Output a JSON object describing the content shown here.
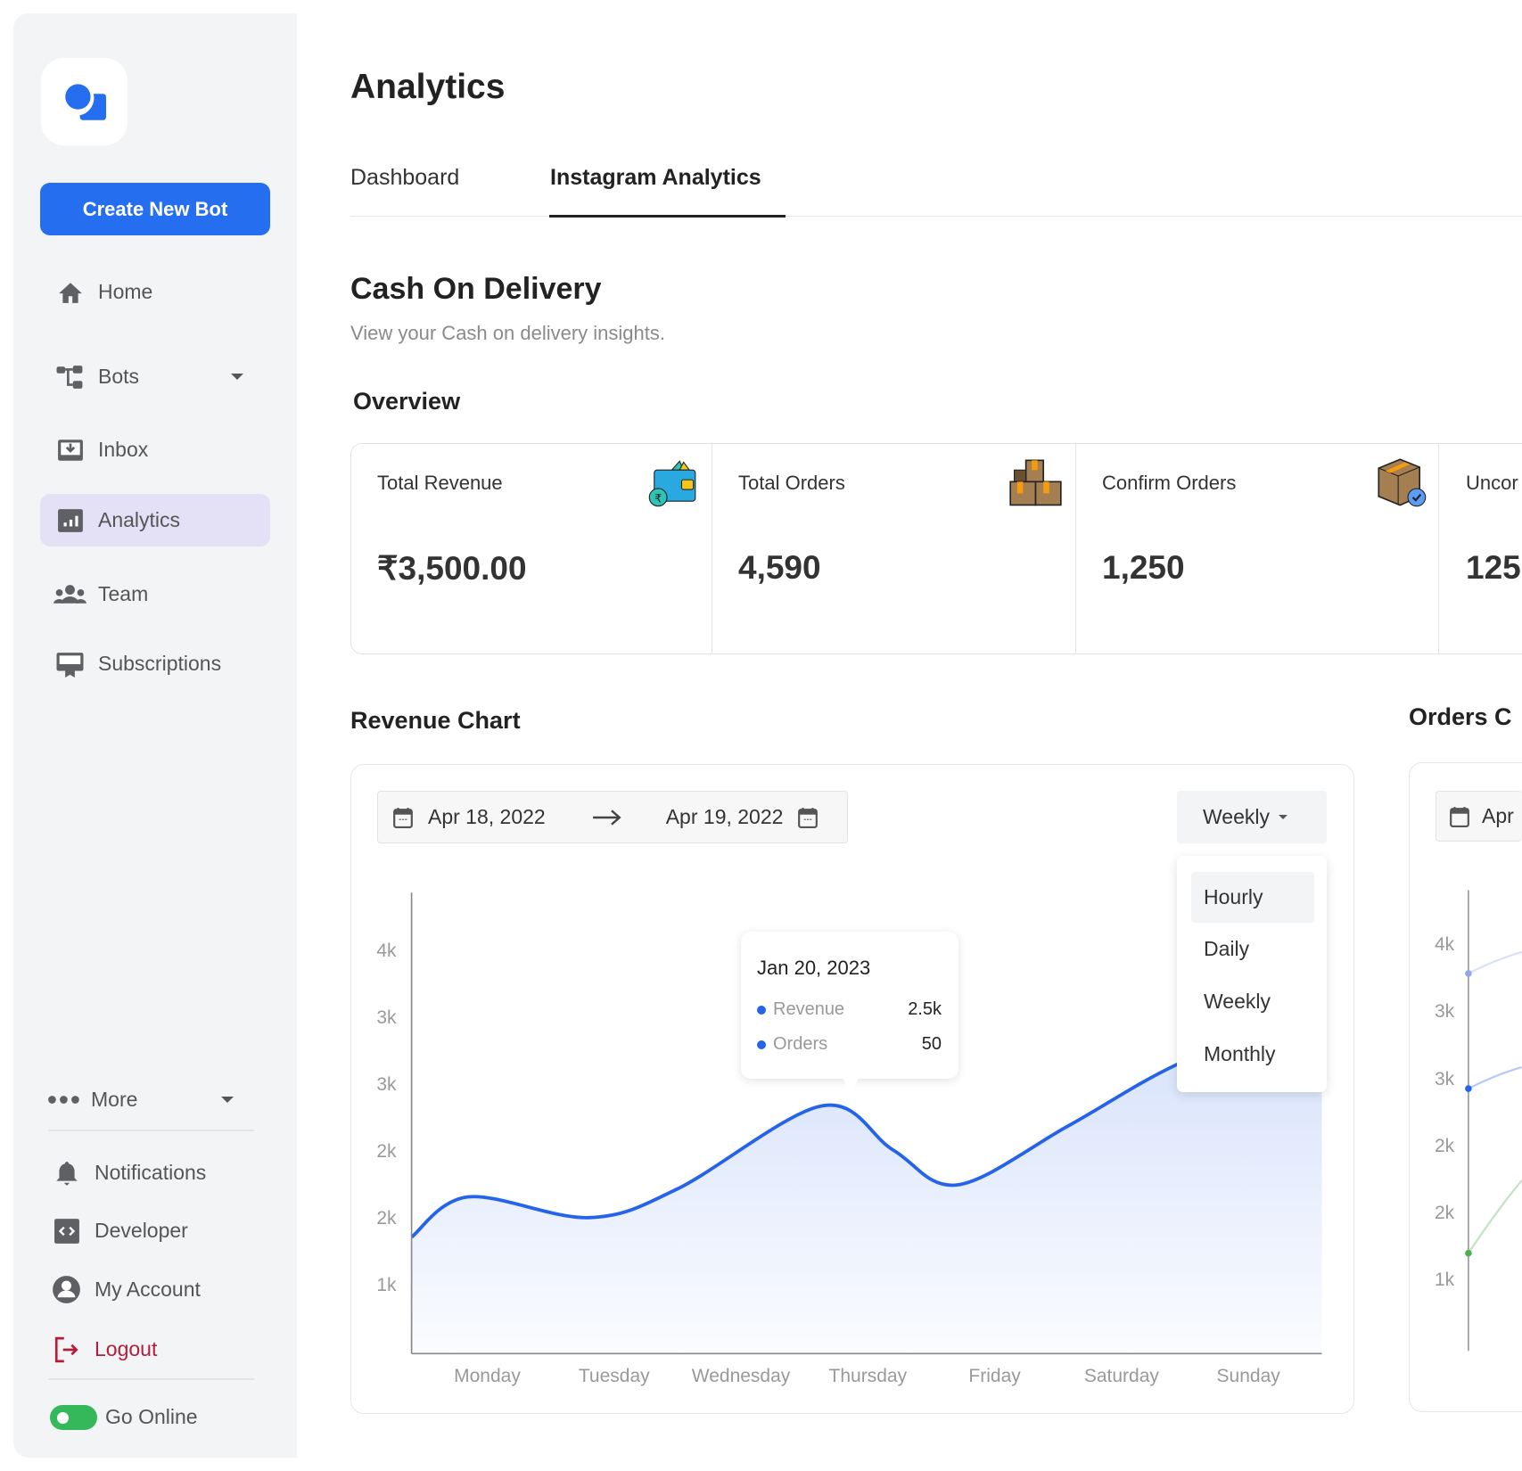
{
  "sidebar": {
    "create_button": "Create New Bot",
    "items": [
      {
        "label": "Home",
        "icon": "home-icon"
      },
      {
        "label": "Bots",
        "icon": "bots-flow-icon"
      },
      {
        "label": "Inbox",
        "icon": "inbox-icon"
      },
      {
        "label": "Analytics",
        "icon": "analytics-icon",
        "active": true
      },
      {
        "label": "Team",
        "icon": "team-icon"
      },
      {
        "label": "Subscriptions",
        "icon": "subscriptions-icon"
      }
    ],
    "more": "More",
    "bottom_items": [
      {
        "label": "Notifications",
        "icon": "bell-icon"
      },
      {
        "label": "Developer",
        "icon": "code-icon"
      },
      {
        "label": "My Account",
        "icon": "account-icon"
      },
      {
        "label": "Logout",
        "icon": "logout-icon"
      }
    ],
    "go_online": "Go Online",
    "go_online_on": true
  },
  "colors": {
    "accent": "#256ef0",
    "active_nav": "#e4e0f5",
    "logout": "#b31d3c",
    "toggle": "#34b85a"
  },
  "header": {
    "title": "Analytics",
    "tabs": [
      "Dashboard",
      "Instagram Analytics"
    ],
    "active_tab": 1
  },
  "section": {
    "title": "Cash On Delivery",
    "subtitle": "View your Cash on delivery insights.",
    "overview": "Overview"
  },
  "cards": [
    {
      "label": "Total Revenue",
      "value": "₹3,500.00",
      "icon": "wallet-rupee-icon"
    },
    {
      "label": "Total Orders",
      "value": "4,590",
      "icon": "boxes-icon"
    },
    {
      "label": "Confirm Orders",
      "value": "1,250",
      "icon": "box-check-icon"
    },
    {
      "label": "Uncor",
      "value": "125"
    }
  ],
  "revenue_chart": {
    "title": "Revenue Chart",
    "date_from": "Apr 18, 2022",
    "date_to": "Apr 19, 2022",
    "period": "Weekly",
    "period_options": [
      "Hourly",
      "Daily",
      "Weekly",
      "Monthly"
    ],
    "highlighted_option": "Hourly",
    "tooltip": {
      "date": "Jan 20, 2023",
      "rows": [
        {
          "label": "Revenue",
          "value": "2.5k"
        },
        {
          "label": "Orders",
          "value": "50"
        }
      ]
    }
  },
  "orders_chart": {
    "title": "Orders C",
    "date_from": "Apr"
  },
  "chart_data": [
    {
      "type": "area",
      "title": "Revenue Chart",
      "categories": [
        "Monday",
        "Tuesday",
        "Wednesday",
        "Thursday",
        "Friday",
        "Saturday",
        "Sunday"
      ],
      "y_ticks": [
        {
          "value": 4000,
          "label": "4k"
        },
        {
          "value": 3500,
          "label": "3k"
        },
        {
          "value": 3000,
          "label": "3k"
        },
        {
          "value": 2500,
          "label": "2k"
        },
        {
          "value": 2000,
          "label": "2k"
        },
        {
          "value": 1500,
          "label": "1k"
        }
      ],
      "ylim": [
        1000,
        4600
      ],
      "color": "#2563eb",
      "points": [
        [
          -0.6,
          1870
        ],
        [
          -0.15,
          2170
        ],
        [
          0.8,
          2015
        ],
        [
          1.5,
          2230
        ],
        [
          2.64,
          2850
        ],
        [
          3.2,
          2520
        ],
        [
          3.71,
          2260
        ],
        [
          4.58,
          2700
        ],
        [
          5.44,
          3160
        ],
        [
          6.58,
          3600
        ]
      ],
      "grid": false
    },
    {
      "type": "line",
      "title": "Orders C",
      "y_ticks": [
        {
          "value": 4000,
          "label": "4k"
        },
        {
          "value": 3500,
          "label": "3k"
        },
        {
          "value": 3000,
          "label": "3k"
        },
        {
          "value": 2500,
          "label": "2k"
        },
        {
          "value": 2000,
          "label": "2k"
        },
        {
          "value": 1500,
          "label": "1k"
        }
      ],
      "series_start_values": [
        {
          "value": 3820,
          "color": "#8fa8e8"
        },
        {
          "value": 2960,
          "color": "#2563eb"
        },
        {
          "value": 1730,
          "color": "#4caf50"
        }
      ]
    }
  ]
}
